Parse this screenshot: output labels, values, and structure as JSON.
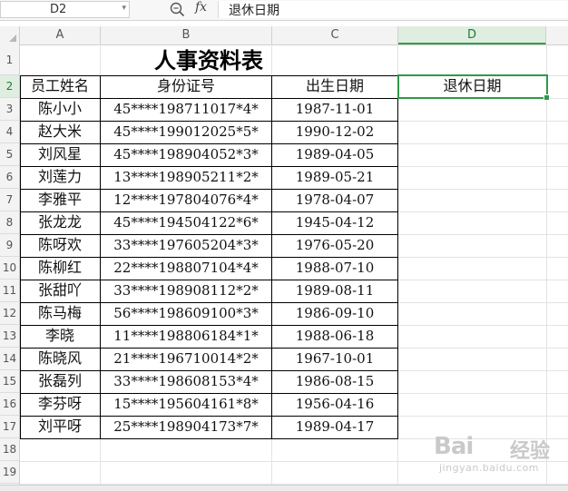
{
  "name_box": {
    "value": "D2"
  },
  "formula_bar": {
    "fx_label": "fx",
    "value": "退休日期"
  },
  "columns": [
    "A",
    "B",
    "C",
    "D"
  ],
  "selected_column": "D",
  "rows": [
    "1",
    "2",
    "3",
    "4",
    "5",
    "6",
    "7",
    "8",
    "9",
    "10",
    "11",
    "12",
    "13",
    "14",
    "15",
    "16",
    "17",
    "18",
    "19"
  ],
  "selected_row": "2",
  "sheet": {
    "title": "人事资料表",
    "headers": [
      "员工姓名",
      "身份证号",
      "出生日期",
      "退休日期"
    ],
    "records": [
      [
        "陈小小",
        "45****198711017*4*",
        "1987-11-01"
      ],
      [
        "赵大米",
        "45****199012025*5*",
        "1990-12-02"
      ],
      [
        "刘风星",
        "45****198904052*3*",
        "1989-04-05"
      ],
      [
        "刘莲力",
        "13****198905211*2*",
        "1989-05-21"
      ],
      [
        "李雅平",
        "12****197804076*4*",
        "1978-04-07"
      ],
      [
        "张龙龙",
        "45****194504122*6*",
        "1945-04-12"
      ],
      [
        "陈呀欢",
        "33****197605204*3*",
        "1976-05-20"
      ],
      [
        "陈柳红",
        "22****198807104*4*",
        "1988-07-10"
      ],
      [
        "张甜吖",
        "33****198908112*2*",
        "1989-08-11"
      ],
      [
        "陈马梅",
        "56****198609100*3*",
        "1986-09-10"
      ],
      [
        "李晓",
        "11****198806184*1*",
        "1988-06-18"
      ],
      [
        "陈晓风",
        "21****196710014*2*",
        "1967-10-01"
      ],
      [
        "张磊列",
        "33****198608153*4*",
        "1986-08-15"
      ],
      [
        "李芬呀",
        "15****195604161*8*",
        "1956-04-16"
      ],
      [
        "刘平呀",
        "25****198904173*7*",
        "1989-04-17"
      ]
    ]
  },
  "watermark": {
    "brand": "Bai",
    "brand_suffix": "经验",
    "subtext": "jingyan.baidu.com"
  },
  "colors": {
    "selection_green": "#2e9a47",
    "header_bg": "#f3f3f3"
  }
}
